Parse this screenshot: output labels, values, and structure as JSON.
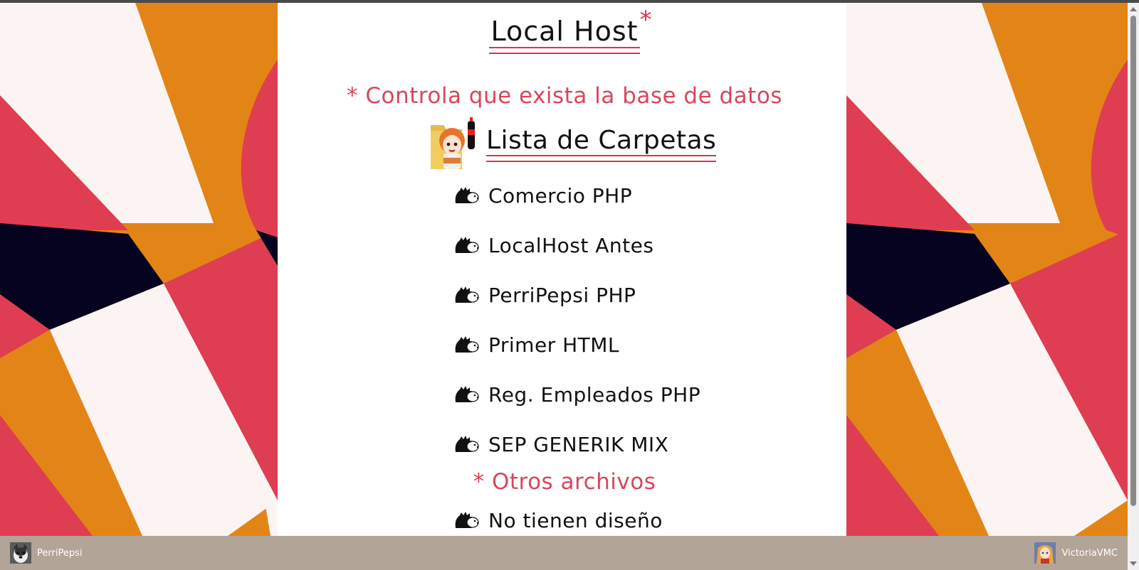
{
  "header": {
    "title": "Local Host",
    "title_mark": "*"
  },
  "notices": {
    "db_check": "* Controla que exista la base de datos",
    "other_files": "* Otros archivos"
  },
  "folders": {
    "heading": "Lista de Carpetas",
    "items": [
      {
        "label": "Comercio PHP"
      },
      {
        "label": "LocalHost Antes"
      },
      {
        "label": "PerriPepsi PHP"
      },
      {
        "label": "Primer HTML"
      },
      {
        "label": "Reg. Empleados PHP"
      },
      {
        "label": "SEP GENERIK MIX"
      }
    ]
  },
  "other_files": {
    "items": [
      {
        "label": "No tienen diseño"
      }
    ]
  },
  "footer": {
    "left_user": "PerriPepsi",
    "right_user": "VictoriaVMC"
  },
  "colors": {
    "accent_red": "#d9364c",
    "bg_orange": "#e38516",
    "bg_red": "#df3d51",
    "bg_cream": "#fbf4f3",
    "bg_navy": "#050320",
    "footer_bg": "#b3a498"
  },
  "icons": {
    "folder_mascot": "folder-mascot-icon",
    "list_bullet": "hedgehog-icon",
    "left_avatar": "dog-avatar-icon",
    "right_avatar": "girl-avatar-icon"
  }
}
